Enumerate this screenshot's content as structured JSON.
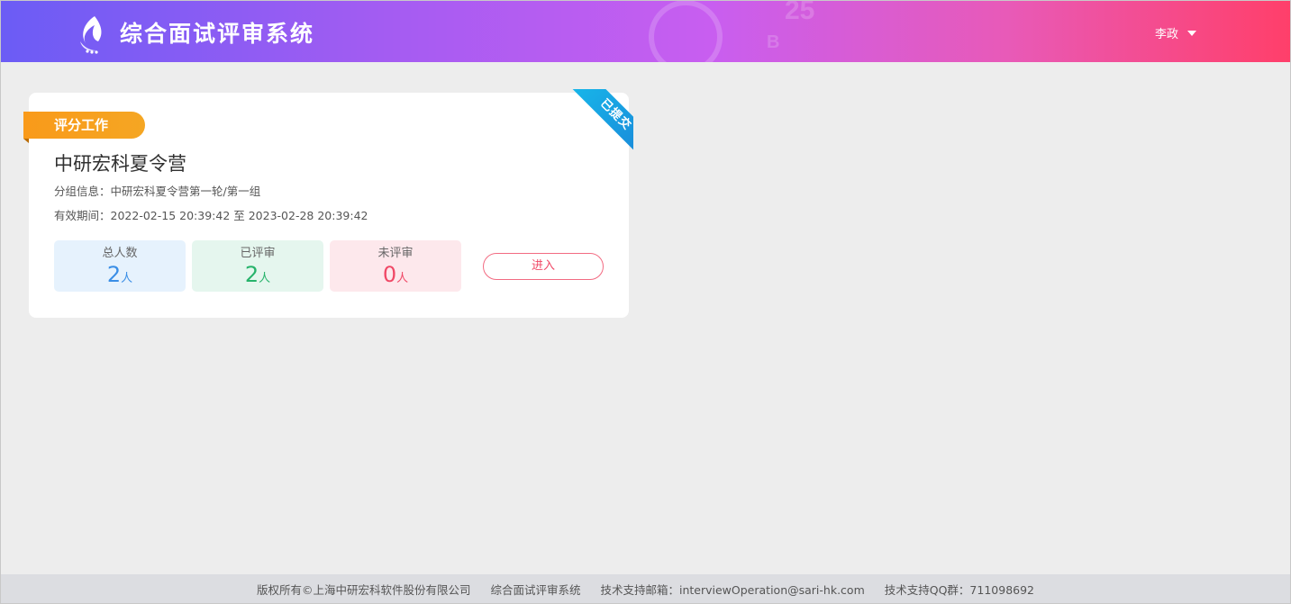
{
  "header": {
    "app_title": "综合面试评审系统",
    "user_name": "李政",
    "logo_icon": "flame-logo-icon"
  },
  "card": {
    "tag": "评分工作",
    "ribbon": "已提交",
    "title": "中研宏科夏令营",
    "group_label": "分组信息：",
    "group_value": "中研宏科夏令营第一轮/第一组",
    "period_label": "有效期间：",
    "period_value": "2022-02-15 20:39:42 至 2023-02-28 20:39:42",
    "stats": {
      "total": {
        "label": "总人数",
        "value": "2",
        "unit": "人",
        "color": "#3a8ee6"
      },
      "reviewed": {
        "label": "已评审",
        "value": "2",
        "unit": "人",
        "color": "#27b36b"
      },
      "unreviewed": {
        "label": "未评审",
        "value": "0",
        "unit": "人",
        "color": "#f04866"
      }
    },
    "enter_label": "进入"
  },
  "footer": {
    "copyright": "版权所有©上海中研宏科软件股份有限公司",
    "system_name": "综合面试评审系统",
    "email": "技术支持邮箱：interviewOperation@sari-hk.com",
    "qq": "技术支持QQ群：711098692"
  },
  "colors": {
    "header_start": "#6b5cf5",
    "header_end": "#ff3f6a",
    "tag": "#f99a1a",
    "ribbon": "#1a9ee0",
    "accent_pink": "#f04866"
  }
}
